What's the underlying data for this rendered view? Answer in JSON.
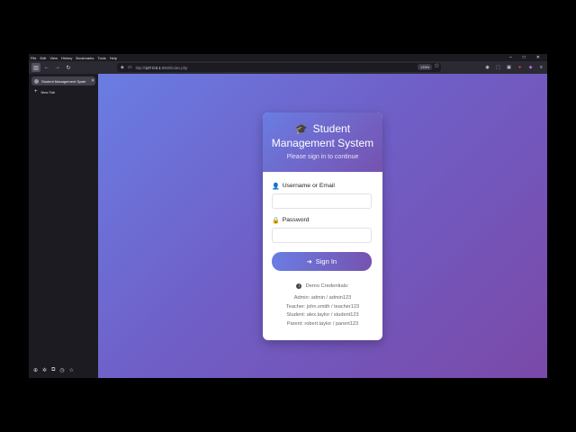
{
  "browser": {
    "menu": [
      "File",
      "Edit",
      "View",
      "History",
      "Bookmarks",
      "Tools",
      "Help"
    ],
    "url_prefix": "http://",
    "url_host": "127.0.0.1",
    "url_path": ":8080/index.php",
    "zoom": "133%",
    "tab_title": "Student Management Syste",
    "new_tab_label": "New Tab"
  },
  "login": {
    "title": "Student Management System",
    "subtitle": "Please sign in to continue",
    "username_label": "Username or Email",
    "username_value": "",
    "password_label": "Password",
    "password_value": "",
    "signin_label": "Sign In",
    "demo_title": "Demo Credentials:",
    "credentials": [
      "Admin: admin / admin123",
      "Teacher: john.smith / teacher123",
      "Student: alex.taylor / student123",
      "Parent: robert.taylor / parent123"
    ]
  },
  "colors": {
    "gradient_start": "#6a7de3",
    "gradient_end": "#7652b0",
    "browser_chrome": "#1c1b22"
  },
  "icons": {
    "title_icon": "graduation-cap-icon",
    "username_icon": "user-icon",
    "password_icon": "lock-icon",
    "signin_icon": "sign-in-icon",
    "demo_icon": "info-circle-icon"
  }
}
